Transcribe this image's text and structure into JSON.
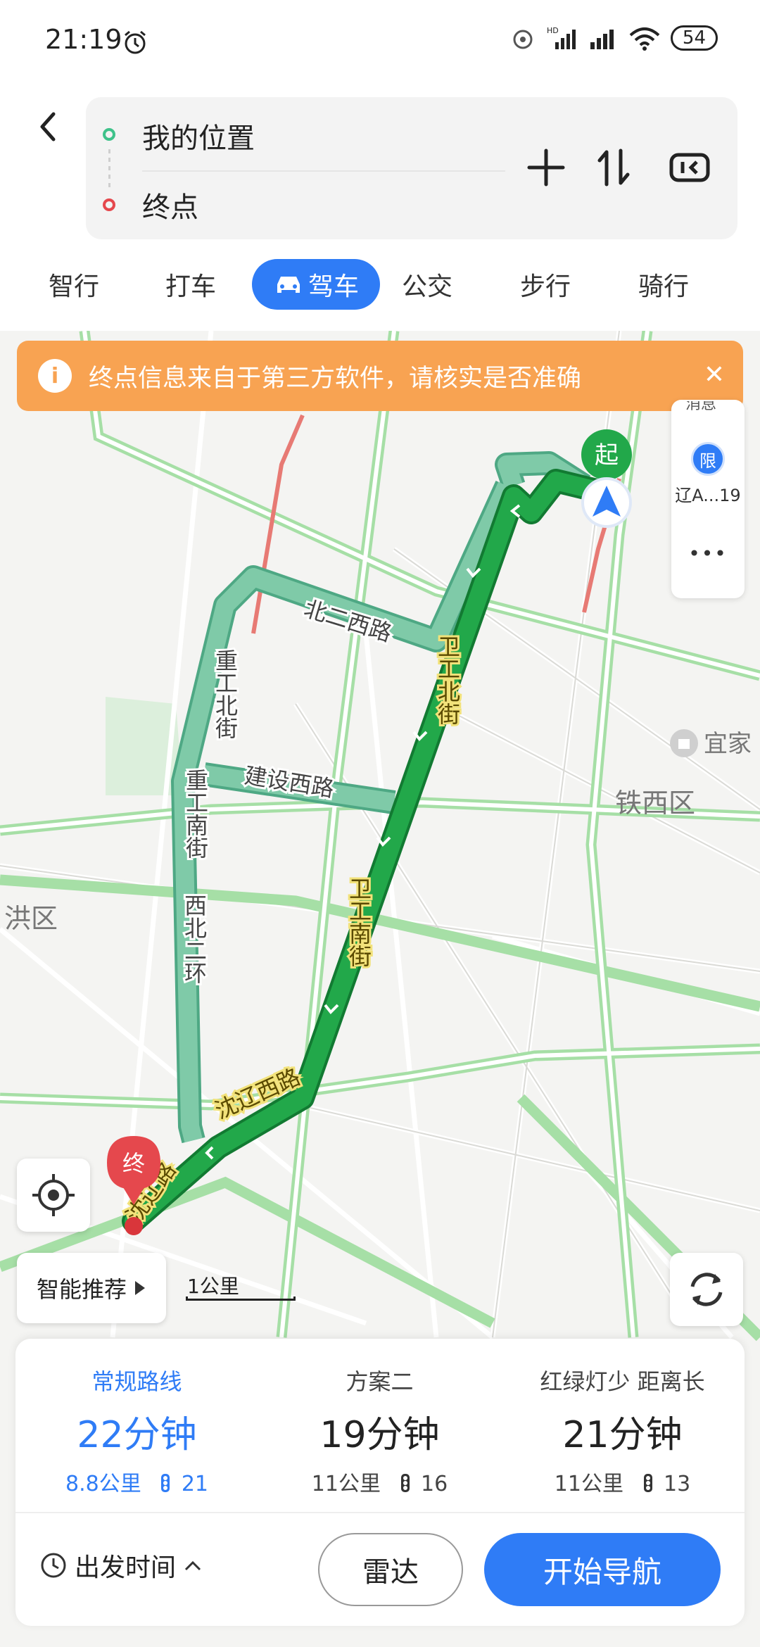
{
  "status_bar": {
    "time": "21:19",
    "battery": "54",
    "hd": "HD"
  },
  "route": {
    "origin": "我的位置",
    "destination": "终点"
  },
  "modes": [
    {
      "label": "智行"
    },
    {
      "label": "打车"
    },
    {
      "label": "驾车",
      "active": true
    },
    {
      "label": "公交"
    },
    {
      "label": "步行"
    },
    {
      "label": "骑行"
    }
  ],
  "banner": {
    "text": "终点信息来自于第三方软件，请核实是否准确",
    "info_glyph": "i",
    "close_glyph": "✕"
  },
  "map": {
    "start_marker": "起",
    "end_marker": "终",
    "labels": {
      "beier_xilu": "北二西路",
      "zhonggong_beijie": "重工北街",
      "zhonggong_nanjie": "重工南街",
      "jianshe_xilu": "建设西路",
      "weigong_beijie": "卫工北街",
      "weigong_nanjie": "卫工南街",
      "xibei_erhuan": "西北二环",
      "shenliao_xilu": "沈辽西路",
      "shenliao_lu": "沈辽路",
      "tiexi_qu": "铁西区",
      "hongqu": "洪区",
      "yijia": "宜家"
    },
    "side_panel": {
      "top_partial": "消息",
      "limit_badge": "限",
      "plate": "辽A...19",
      "more": "•••"
    },
    "smart_recommend": "智能推荐",
    "scale": "1公里"
  },
  "colors": {
    "accent": "#2f7cf6",
    "route_main": "#22a84a",
    "route_alt": "#7fcaa8",
    "road": "#a6dfa6",
    "banner": "#f8a352"
  },
  "options": [
    {
      "label": "常规路线",
      "time": "22分钟",
      "distance": "8.8公里",
      "lights": "21",
      "active": true
    },
    {
      "label": "方案二",
      "time": "19分钟",
      "distance": "11公里",
      "lights": "16"
    },
    {
      "label": "红绿灯少 距离长",
      "time": "21分钟",
      "distance": "11公里",
      "lights": "13"
    }
  ],
  "actions": {
    "depart_time": "出发时间",
    "radar": "雷达",
    "navigate": "开始导航"
  }
}
